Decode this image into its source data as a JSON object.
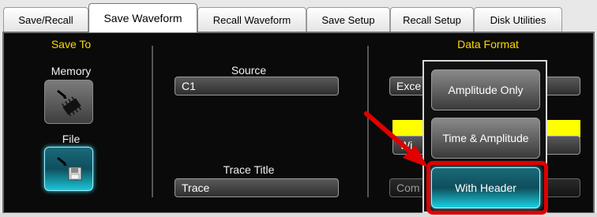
{
  "tabs": [
    {
      "label": "Save/Recall",
      "active": false
    },
    {
      "label": "Save Waveform",
      "active": true
    },
    {
      "label": "Recall Waveform",
      "active": false
    },
    {
      "label": "Save Setup",
      "active": false
    },
    {
      "label": "Recall Setup",
      "active": false
    },
    {
      "label": "Disk Utilities",
      "active": false
    }
  ],
  "save_to": {
    "heading": "Save To",
    "memory_label": "Memory",
    "file_label": "File",
    "selected": "File"
  },
  "source": {
    "label": "Source",
    "value": "C1"
  },
  "trace_title": {
    "label": "Trace Title",
    "value": "Trace"
  },
  "data_format": {
    "heading": "Data Format",
    "field_value_partial": "Exce",
    "field2_partial": "Wi",
    "field3_partial": "Com"
  },
  "popup": {
    "options": [
      "Amplitude Only",
      "Time & Amplitude",
      "With Header"
    ],
    "selected": "With Header"
  },
  "colors": {
    "accent_yellow": "#ffd800",
    "selected_cyan": "#1ac6d8",
    "highlight_red": "#e00000"
  }
}
